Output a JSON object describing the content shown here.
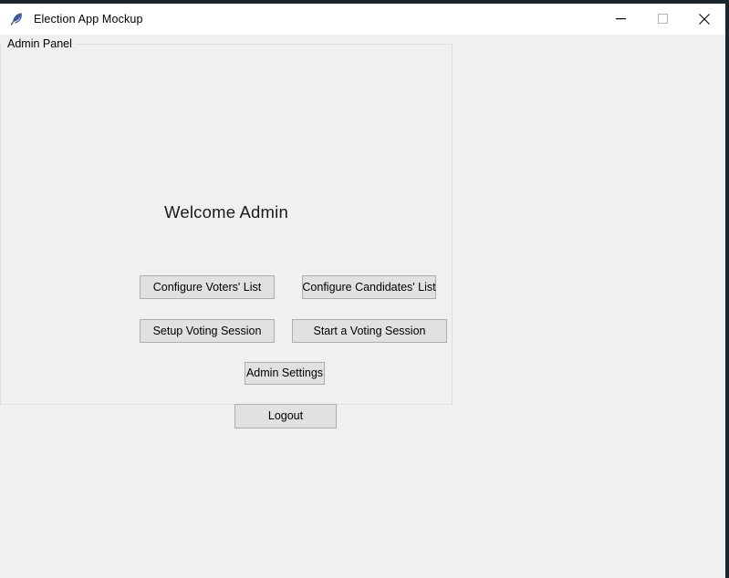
{
  "window": {
    "title": "Election App Mockup",
    "icon": "feather-icon",
    "controls": {
      "minimize": "minimize-icon",
      "maximize": "maximize-icon",
      "close": "close-icon"
    }
  },
  "panel": {
    "legend": "Admin Panel",
    "heading": "Welcome Admin",
    "buttons": [
      {
        "id": "configure-voters",
        "label": "Configure Voters' List"
      },
      {
        "id": "configure-candidates",
        "label": "Configure Candidates' List"
      },
      {
        "id": "setup-voting-session",
        "label": "Setup Voting Session"
      },
      {
        "id": "start-voting-session",
        "label": "Start a Voting Session"
      },
      {
        "id": "admin-settings",
        "label": "Admin Settings"
      },
      {
        "id": "logout",
        "label": "Logout"
      }
    ]
  },
  "colors": {
    "window_background": "#f0f0f0",
    "titlebar_background": "#ffffff",
    "button_face": "#e1e1e1",
    "button_border": "#adadad",
    "panel_border": "#dfdfdf",
    "text": "#000000",
    "desktop": "#1c252c"
  }
}
